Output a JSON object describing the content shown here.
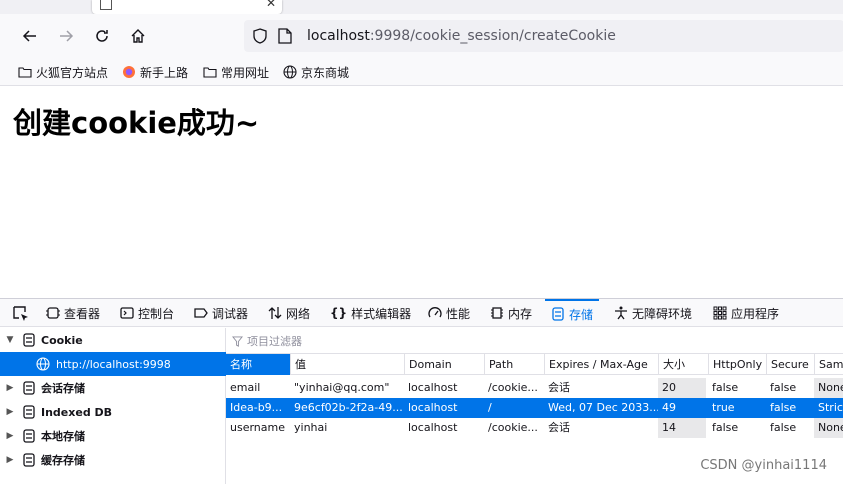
{
  "browser": {
    "url_host": "localhost",
    "url_rest": ":9998/cookie_session/createCookie",
    "bookmarks": [
      "火狐官方站点",
      "新手上路",
      "常用网址",
      "京东商城"
    ]
  },
  "page": {
    "heading": "创建cookie成功~"
  },
  "devtools": {
    "tabs": [
      "查看器",
      "控制台",
      "调试器",
      "网络",
      "样式编辑器",
      "性能",
      "内存",
      "存储",
      "无障碍环境",
      "应用程序"
    ],
    "active_tab": "存储",
    "tree": [
      {
        "label": "Cookie",
        "expanded": true
      },
      {
        "label": "http://localhost:9998",
        "selected": true
      },
      {
        "label": "会话存储"
      },
      {
        "label": "Indexed DB"
      },
      {
        "label": "本地存储"
      },
      {
        "label": "缓存存储"
      }
    ],
    "filter_placeholder": "项目过滤器",
    "columns": [
      "名称",
      "值",
      "Domain",
      "Path",
      "Expires / Max-Age",
      "大小",
      "HttpOnly",
      "Secure",
      "Same"
    ],
    "rows": [
      [
        "email",
        "\"yinhai@qq.com\"",
        "localhost",
        "/cookie...",
        "会话",
        "20",
        "false",
        "false",
        "None"
      ],
      [
        "Idea-b9...",
        "9e6cf02b-2f2a-49...",
        "localhost",
        "/",
        "Wed, 07 Dec 2033...",
        "49",
        "true",
        "false",
        "Strict"
      ],
      [
        "username",
        "yinhai",
        "localhost",
        "/cookie...",
        "会话",
        "14",
        "false",
        "false",
        "None"
      ]
    ]
  },
  "watermark": "CSDN @yinhai1114",
  "colors": {
    "accent": "#0074e8",
    "chrome_bg": "#f9f9fb"
  }
}
